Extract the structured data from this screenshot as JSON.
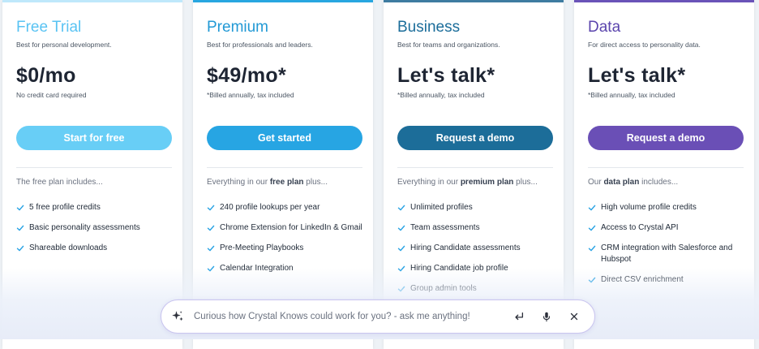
{
  "colors": {
    "check": "#29a3e4",
    "text_dark": "#1e2533"
  },
  "plans": [
    {
      "id": "free",
      "title": "Free Trial",
      "title_color": "#59c3f3",
      "accent": "#bfe8fb",
      "subtitle": "Best for personal development.",
      "price": "$0/mo",
      "price_note": "No credit card required",
      "cta": "Start for free",
      "cta_color": "#68cef6",
      "includes_pre": "The free plan includes...",
      "includes_bold": "",
      "includes_post": "",
      "features": [
        "5 free profile credits",
        "Basic personality assessments",
        "Shareable downloads"
      ]
    },
    {
      "id": "premium",
      "title": "Premium",
      "title_color": "#2299d5",
      "accent": "#28a6e0",
      "subtitle": "Best for professionals and leaders.",
      "price": "$49/mo*",
      "price_note": "*Billed annually, tax included",
      "cta": "Get started",
      "cta_color": "#27a5e3",
      "includes_pre": "Everything in our ",
      "includes_bold": "free plan",
      "includes_post": " plus...",
      "features": [
        "240 profile lookups per year",
        "Chrome Extension for LinkedIn & Gmail",
        "Pre-Meeting Playbooks",
        "Calendar Integration"
      ]
    },
    {
      "id": "business",
      "title": "Business",
      "title_color": "#1b6d9a",
      "accent": "#3e7ca1",
      "subtitle": "Best for teams and organizations.",
      "price": "Let's talk*",
      "price_note": "*Billed annually, tax included",
      "cta": "Request a demo",
      "cta_color": "#1c6d99",
      "includes_pre": "Everything in our ",
      "includes_bold": "premium plan",
      "includes_post": " plus...",
      "features": [
        "Unlimited profiles",
        "Team assessments",
        "Hiring Candidate assessments",
        "Hiring Candidate job profile",
        "Group admin tools"
      ]
    },
    {
      "id": "data",
      "title": "Data",
      "title_color": "#5b45ad",
      "accent": "#6a53b8",
      "subtitle": "For direct access to personality data.",
      "price": "Let's talk*",
      "price_note": "*Billed annually, tax included",
      "cta": "Request a demo",
      "cta_color": "#6a4fb6",
      "includes_pre": "Our ",
      "includes_bold": "data plan",
      "includes_post": " includes...",
      "features": [
        "High volume profile credits",
        "Access to Crystal API",
        "CRM integration with Salesforce and Hubspot",
        "Direct CSV enrichment"
      ]
    }
  ],
  "chat": {
    "placeholder": "Curious how Crystal Knows could work for you? - ask me anything!",
    "icons": [
      "sparkle-icon",
      "enter-icon",
      "microphone-icon",
      "close-icon"
    ]
  }
}
